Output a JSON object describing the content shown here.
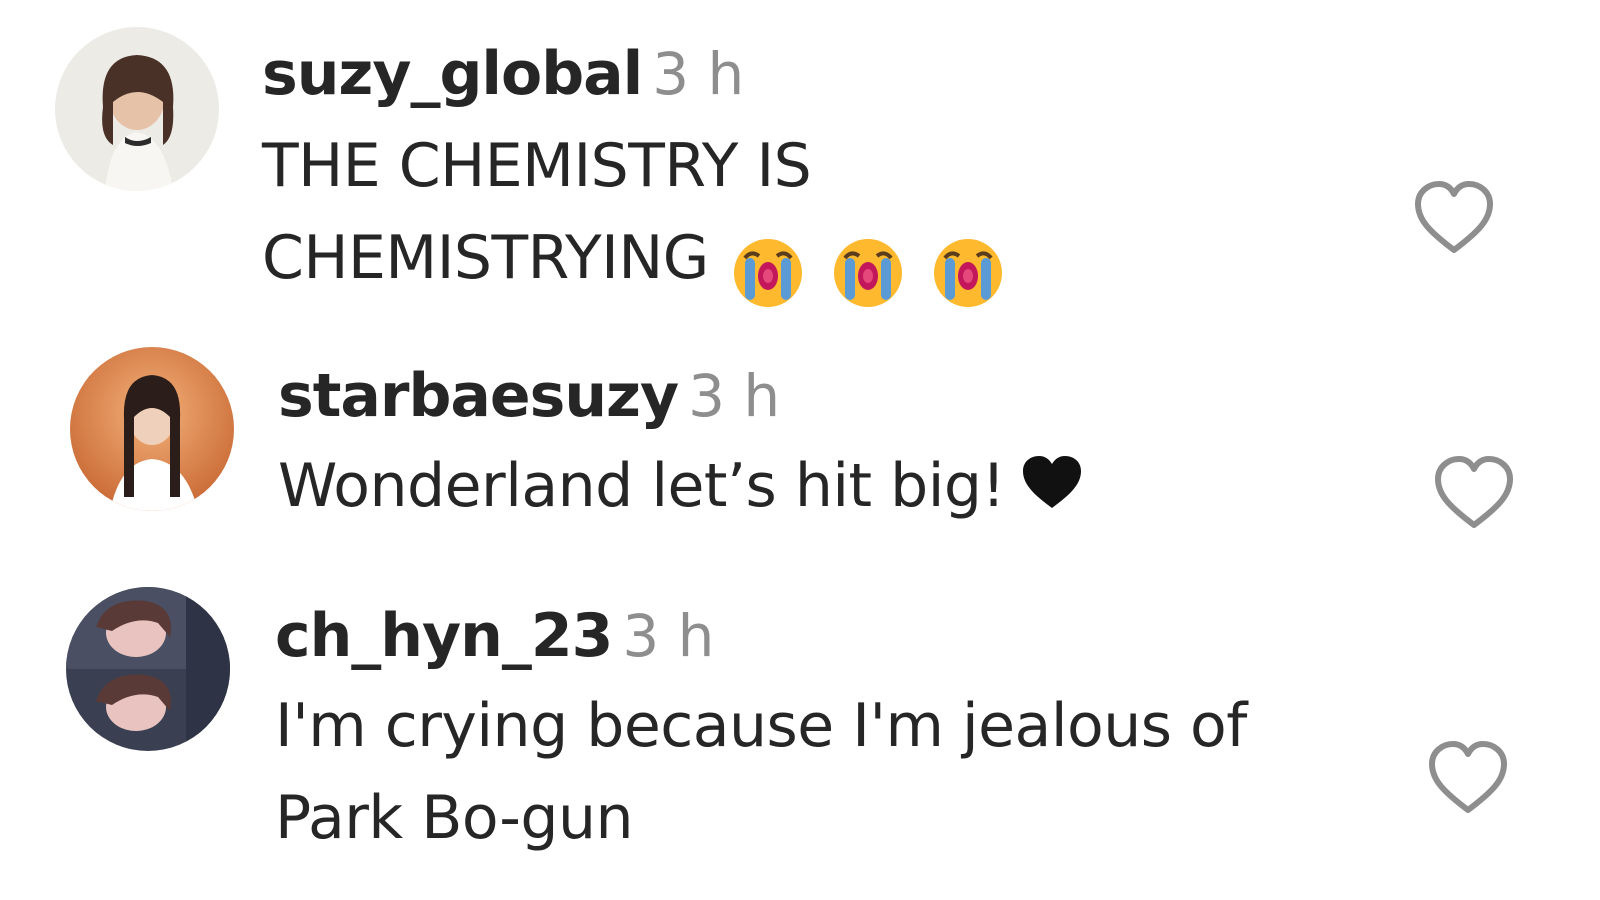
{
  "comments": [
    {
      "username": "suzy_global",
      "time": "3 h",
      "text_line1": "THE CHEMISTRY IS",
      "text_line2": "CHEMISTRYING",
      "emojis": [
        "loudly-crying-face",
        "loudly-crying-face",
        "loudly-crying-face"
      ],
      "like_icon": "heart-outline-icon"
    },
    {
      "username": "starbaesuzy",
      "time": "3 h",
      "text_line1": "Wonderland let’s hit big!",
      "emojis": [
        "black-heart"
      ],
      "like_icon": "heart-outline-icon"
    },
    {
      "username": "ch_hyn_23",
      "time": "3 h",
      "text_line1": "I'm crying because I'm jealous of",
      "text_line2": "Park Bo-gun",
      "like_icon": "heart-outline-icon"
    }
  ],
  "colors": {
    "username": "#262626",
    "time": "#8e8e8e",
    "text": "#262626",
    "like_icon": "#8e8e8e",
    "background": "#ffffff"
  }
}
